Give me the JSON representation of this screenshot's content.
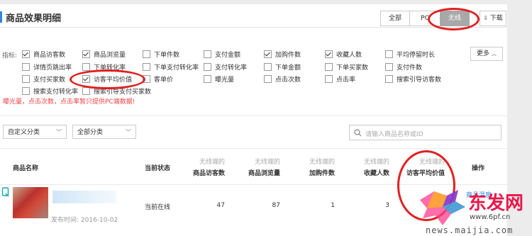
{
  "header": {
    "title": "商品效果明细"
  },
  "tabs": [
    {
      "label": "全部"
    },
    {
      "label": "PC"
    },
    {
      "label": "无线"
    }
  ],
  "download_label": "下载",
  "metrics": {
    "label": "指标:",
    "items": [
      {
        "label": "商品访客数",
        "checked": true
      },
      {
        "label": "商品浏览量",
        "checked": true
      },
      {
        "label": "下单件数",
        "checked": false
      },
      {
        "label": "支付金额",
        "checked": false
      },
      {
        "label": "加购件数",
        "checked": true
      },
      {
        "label": "收藏人数",
        "checked": true
      },
      {
        "label": "平均停留时长",
        "checked": false
      },
      {
        "label": "详情页跳出率",
        "checked": false
      },
      {
        "label": "下单转化率",
        "checked": false
      },
      {
        "label": "下单支付转化率",
        "checked": false
      },
      {
        "label": "支付转化率",
        "checked": false
      },
      {
        "label": "下单金额",
        "checked": false
      },
      {
        "label": "下单买家数",
        "checked": false
      },
      {
        "label": "支付件数",
        "checked": false
      },
      {
        "label": "支付买家数",
        "checked": false
      },
      {
        "label": "访客平均价值",
        "checked": true
      },
      {
        "label": "客单价",
        "checked": false
      },
      {
        "label": "曝光量",
        "checked": false
      },
      {
        "label": "点击次数",
        "checked": false
      },
      {
        "label": "点击率",
        "checked": false
      },
      {
        "label": "搜索引导访客数",
        "checked": false
      },
      {
        "label": "搜索支付转化率",
        "checked": false
      },
      {
        "label": "搜索引导支付买家数",
        "checked": false
      }
    ],
    "more_label": "更多"
  },
  "note": "曝光量，点击次数，点击率暂只提供PC端数据!",
  "filters": {
    "custom_category": "自定义分类",
    "all_category": "全部分类",
    "search_placeholder": "请输入商品名称或ID"
  },
  "table": {
    "col_product": "商品名称",
    "col_status": "当前状态",
    "metric_cols": [
      {
        "sub": "无线端的",
        "main": "商品访客数"
      },
      {
        "sub": "无线端的",
        "main": "商品浏览量"
      },
      {
        "sub": "无线端的",
        "main": "加购件数"
      },
      {
        "sub": "无线端的",
        "main": "收藏人数"
      },
      {
        "sub": "无线端的",
        "main": "访客平均价值"
      }
    ],
    "col_action": "操作",
    "rows": [
      {
        "publish_time": "发布时间: 2016-10-02",
        "status": "当前在线",
        "values": [
          "47",
          "87",
          "1",
          "3",
          ""
        ],
        "action": "商品温度"
      }
    ]
  },
  "watermark": {
    "brand": "东发网",
    "url": "www.6pf.cn",
    "news": "news.maijia.com"
  },
  "colors": {
    "accent": "#2e86de",
    "highlight": "#e02020",
    "note": "#ee4444"
  }
}
